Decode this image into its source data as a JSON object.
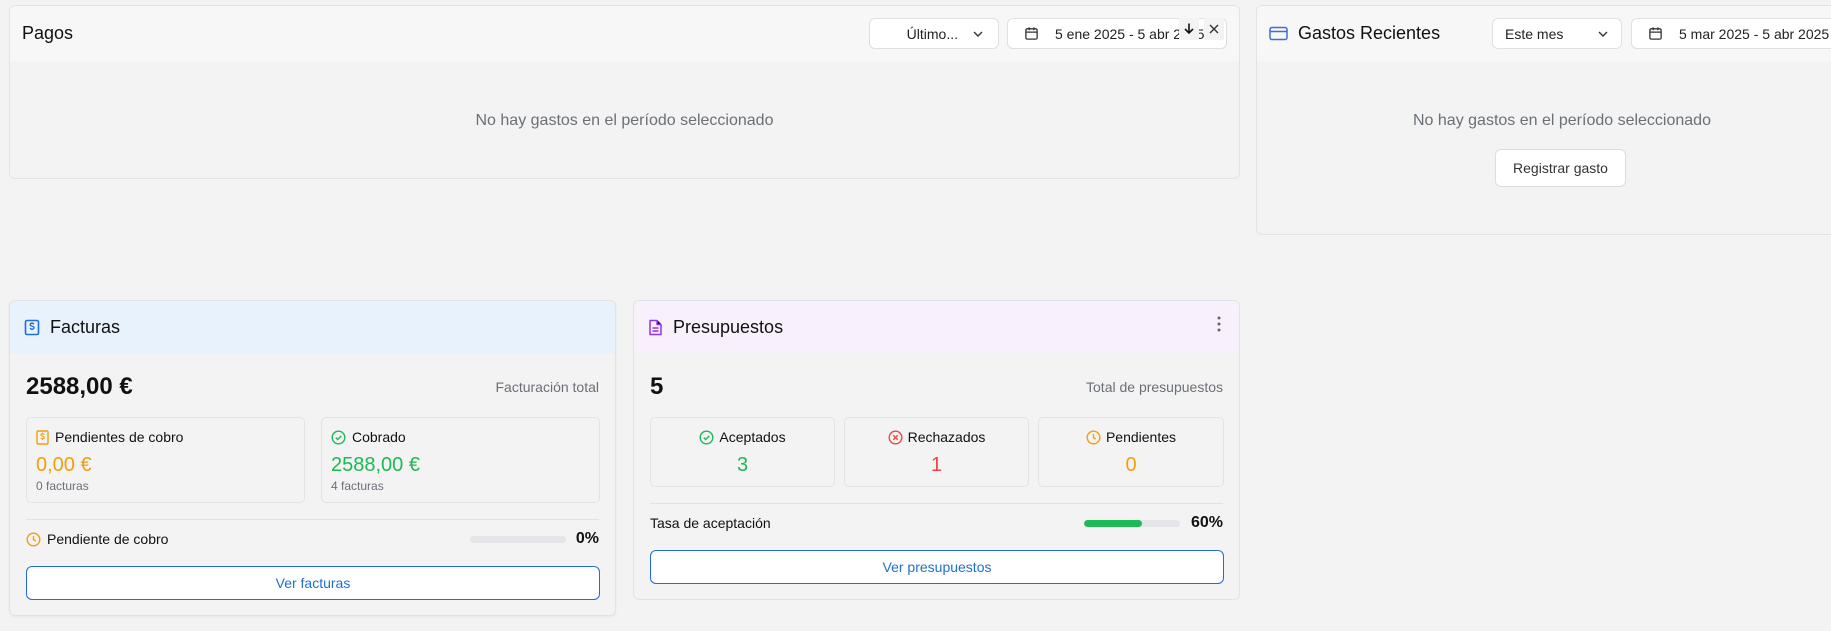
{
  "pagos": {
    "title": "Pagos",
    "period_select": "Último...",
    "date_range": "5 ene 2025 - 5 abr 2025",
    "empty_text": "No hay gastos en el período seleccionado"
  },
  "gastos": {
    "title": "Gastos Recientes",
    "period_select": "Este mes",
    "date_range": "5 mar 2025 - 5 abr 2025",
    "empty_text": "No hay gastos en el período seleccionado",
    "register_button": "Registrar gasto"
  },
  "facturas": {
    "title": "Facturas",
    "total_value": "2588,00 €",
    "total_label": "Facturación total",
    "pending": {
      "label": "Pendientes de cobro",
      "value": "0,00 €",
      "count": "0 facturas"
    },
    "collected": {
      "label": "Cobrado",
      "value": "2588,00 €",
      "count": "4 facturas"
    },
    "progress_label": "Pendiente de cobro",
    "progress_percent_text": "0%",
    "progress_fraction": 0,
    "button": "Ver facturas"
  },
  "presupuestos": {
    "title": "Presupuestos",
    "total_value": "5",
    "total_label": "Total de presupuestos",
    "accepted": {
      "label": "Aceptados",
      "value": "3"
    },
    "rejected": {
      "label": "Rechazados",
      "value": "1"
    },
    "pending": {
      "label": "Pendientes",
      "value": "0"
    },
    "rate_label": "Tasa de aceptación",
    "rate_percent_text": "60%",
    "rate_fraction": 0.6,
    "button": "Ver presupuestos"
  },
  "colors": {
    "accent_blue": "#1f6fd1",
    "green": "#1db954",
    "orange": "#f59e0b",
    "red": "#ef4444",
    "purple": "#9333ea"
  },
  "icons": [
    "calendar-icon",
    "chevron-down-icon",
    "download-icon",
    "close-icon",
    "credit-card-icon",
    "invoice-icon",
    "document-icon",
    "more-vertical-icon",
    "check-circle-icon",
    "x-circle-icon",
    "clock-icon"
  ]
}
